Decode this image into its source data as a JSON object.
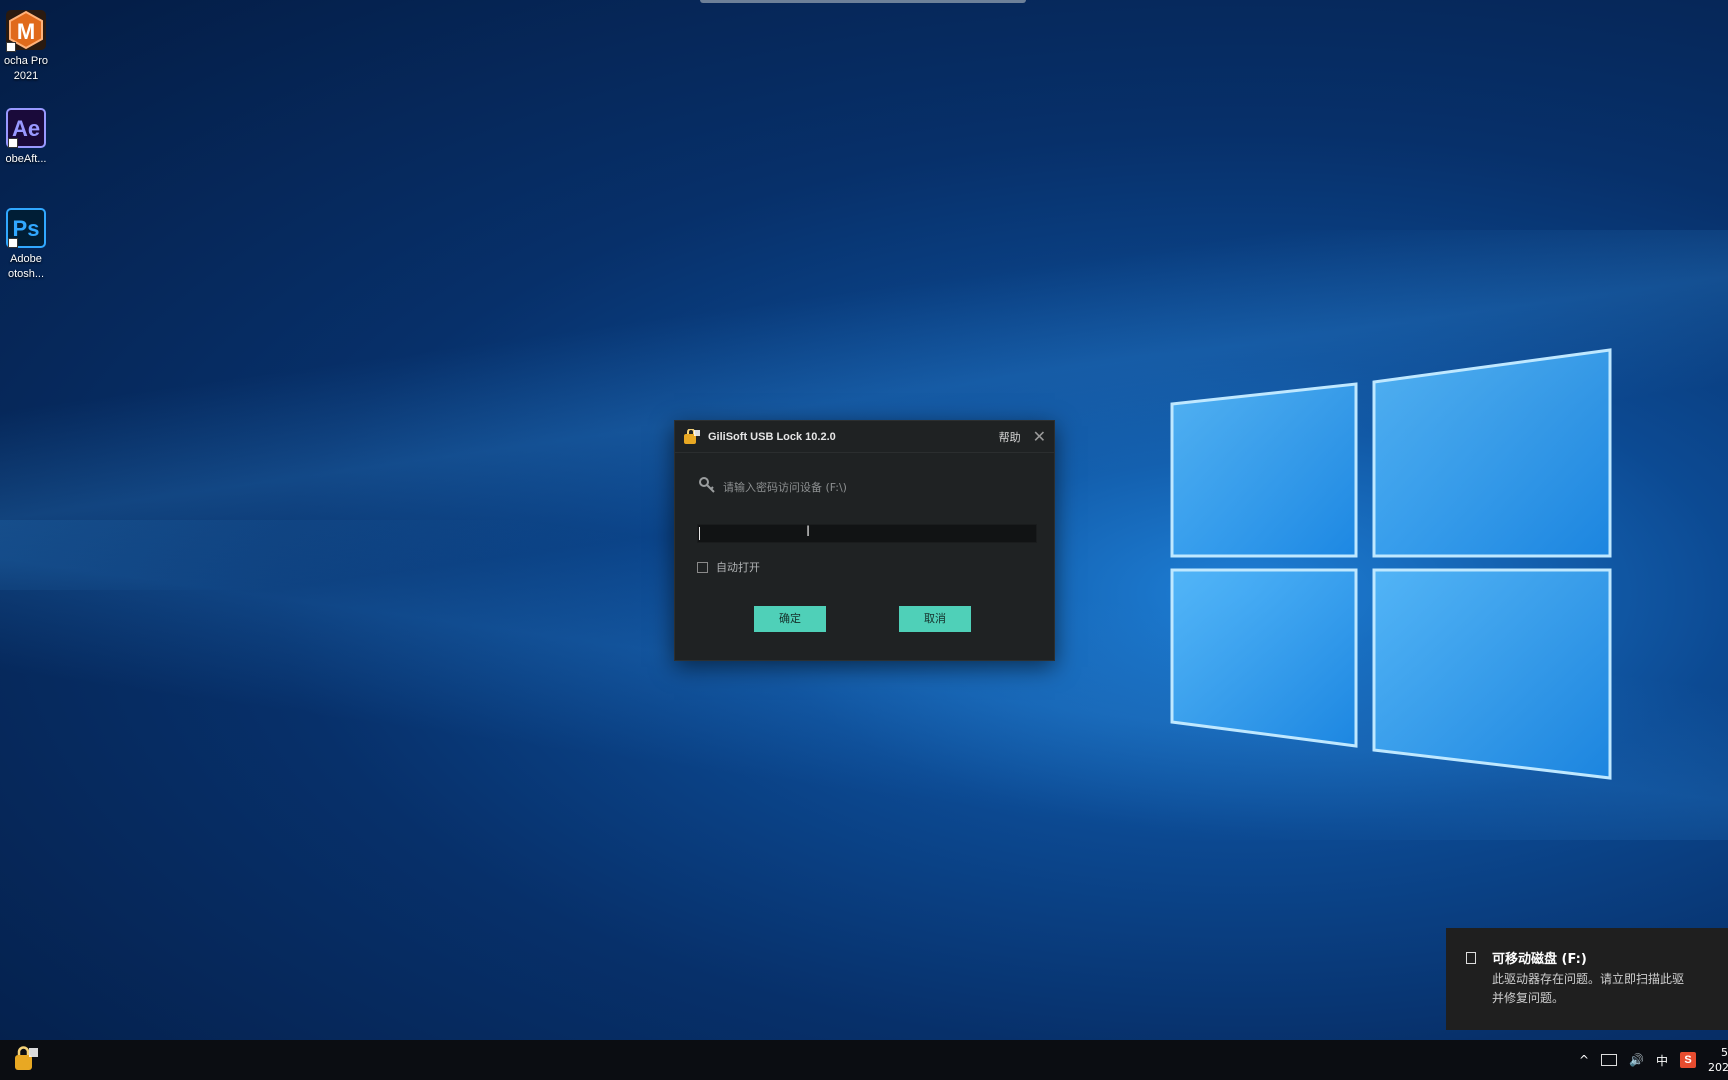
{
  "desktop": {
    "icons": [
      {
        "name": "mocha-pro",
        "glyph": "M",
        "caption_line1": "ocha Pro",
        "caption_line2": "2021",
        "color": "#e06a1b"
      },
      {
        "name": "after-effects",
        "glyph": "Ae",
        "caption_line1": "obeAft...",
        "caption_line2": "",
        "color": "#9999ff"
      },
      {
        "name": "photoshop",
        "glyph": "Ps",
        "caption_line1": "Adobe",
        "caption_line2": "otosh...",
        "color": "#31a8ff"
      }
    ]
  },
  "dialog": {
    "title": "GiliSoft USB Lock 10.2.0",
    "help_label": "帮助",
    "close_glyph": "✕",
    "prompt": "请输入密码访问设备 (F:\\)",
    "password_value": "",
    "ibeam_glyph": "I",
    "auto_open_label": "自动打开",
    "auto_open_checked": false,
    "ok_label": "确定",
    "cancel_label": "取消",
    "accent_color": "#4fd0b8"
  },
  "toast": {
    "title": "可移动磁盘 (F:)",
    "body_line1": "此驱动器存在问题。请立即扫描此驱",
    "body_line2": "并修复问题。"
  },
  "taskbar": {
    "tray_up": "^",
    "volume": "🔊",
    "ime": "中",
    "antivirus_glyph": "S",
    "clock_line1": "5",
    "clock_line2": "202"
  }
}
